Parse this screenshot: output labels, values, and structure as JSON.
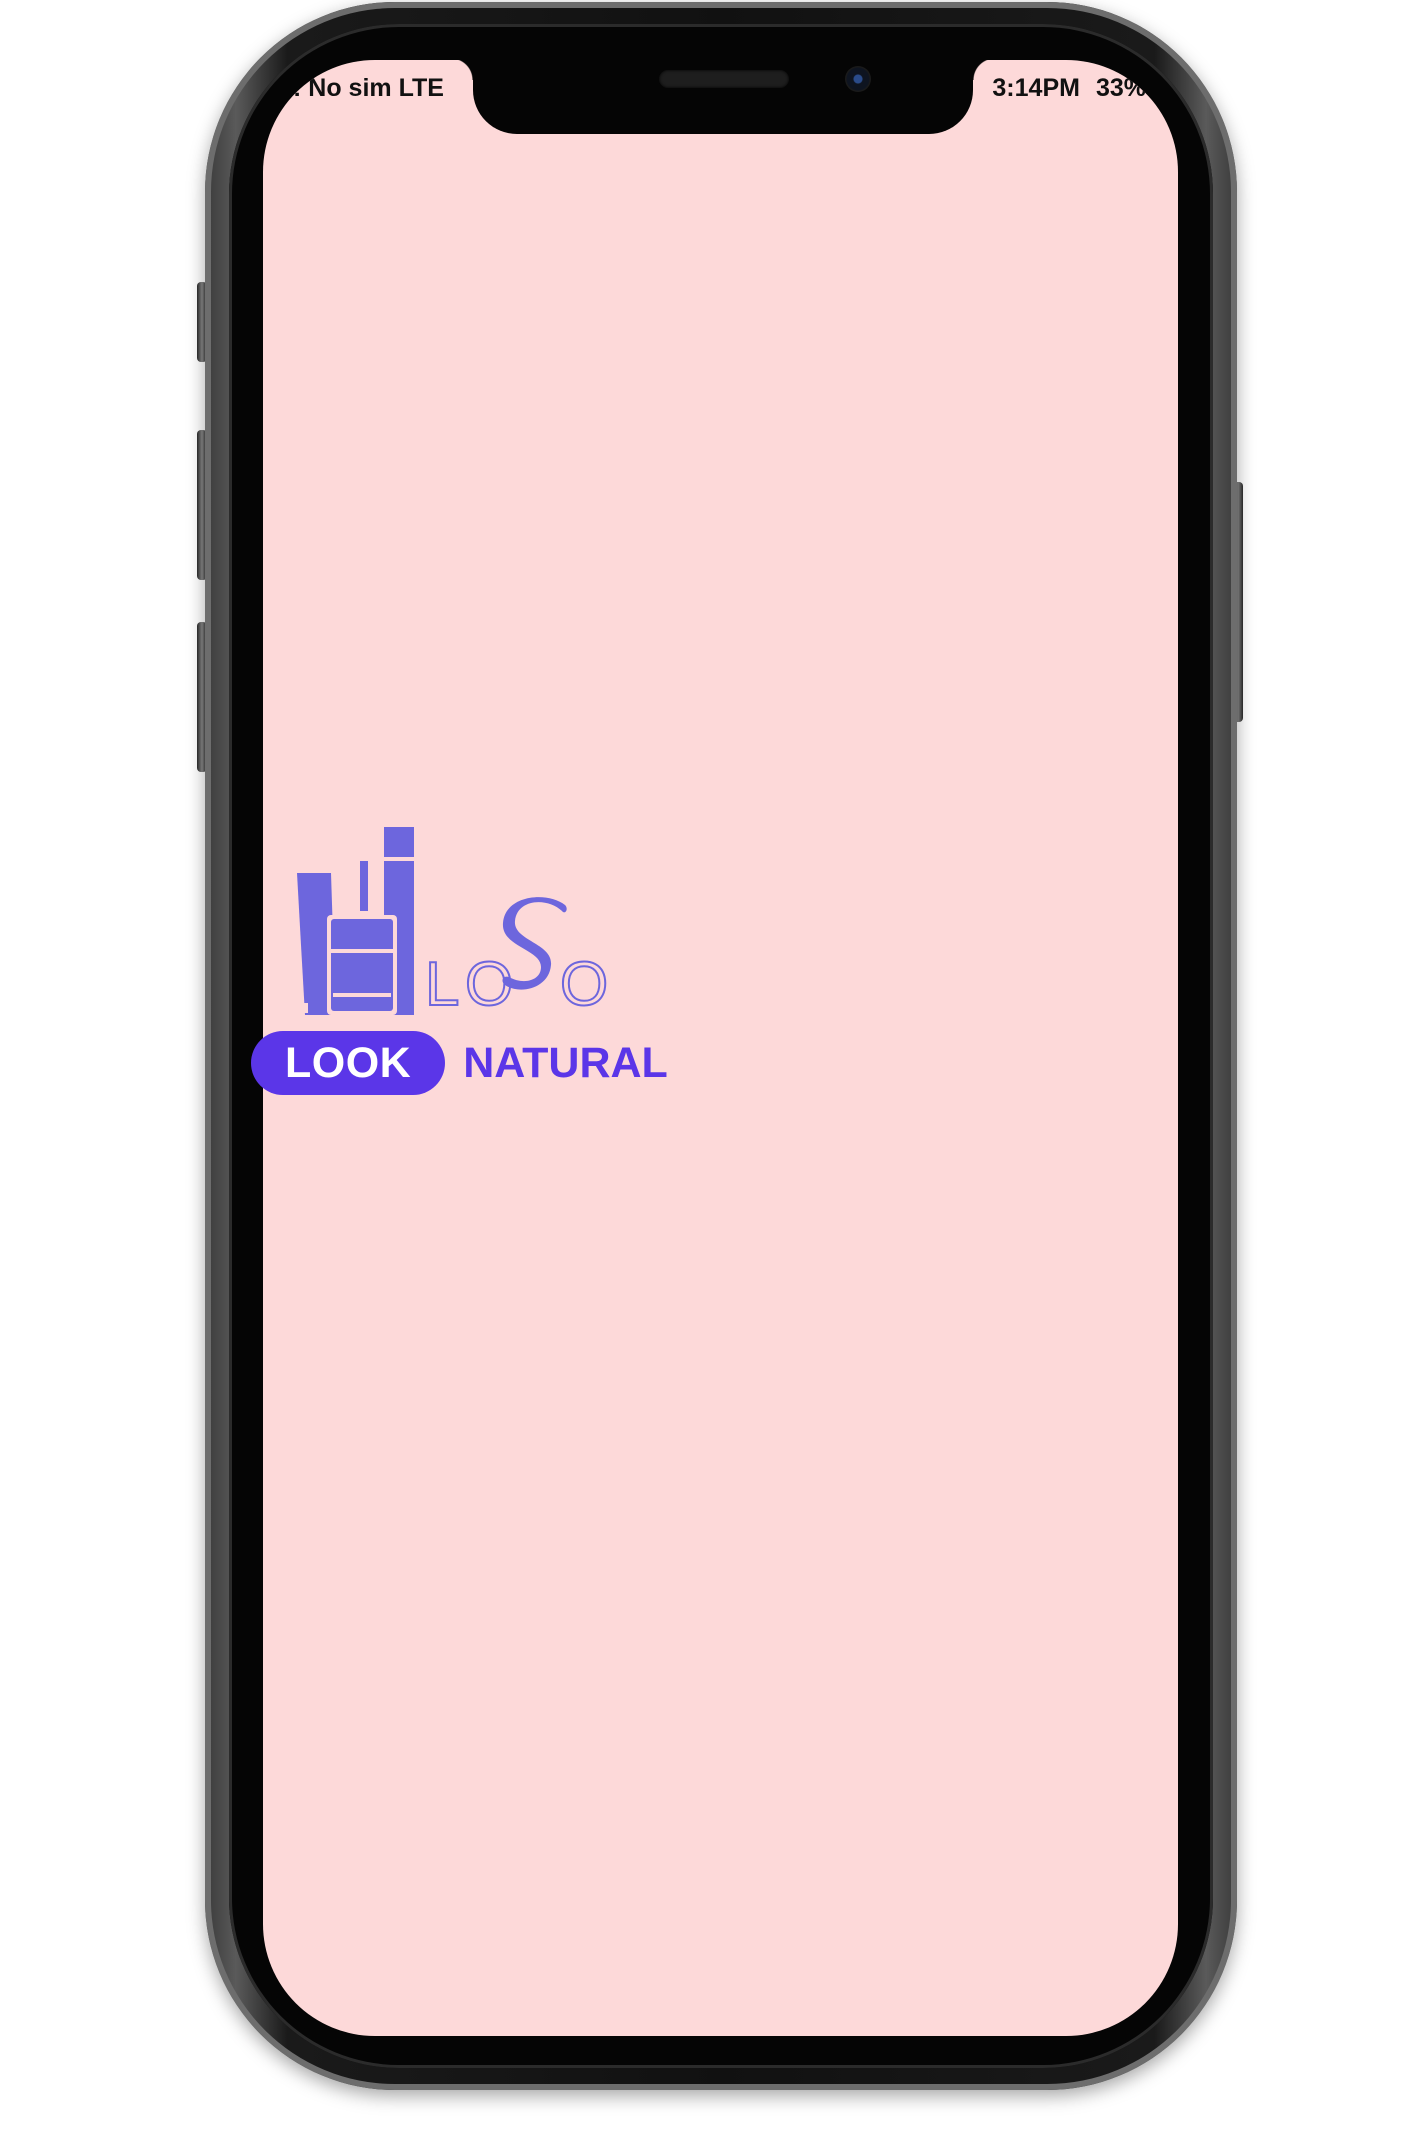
{
  "status_bar": {
    "carrier": "! No sim LTE",
    "time": "3:14PM",
    "battery": "33%"
  },
  "logo": {
    "wordmark": "LoSo",
    "icon": "cosmetics-bottles-icon"
  },
  "tagline": {
    "highlight": "LOOK",
    "rest": "NATURAL"
  },
  "colors": {
    "background": "#fdd9d9",
    "brand_primary": "#5b36e8",
    "logo_mark": "#6d66dd"
  }
}
